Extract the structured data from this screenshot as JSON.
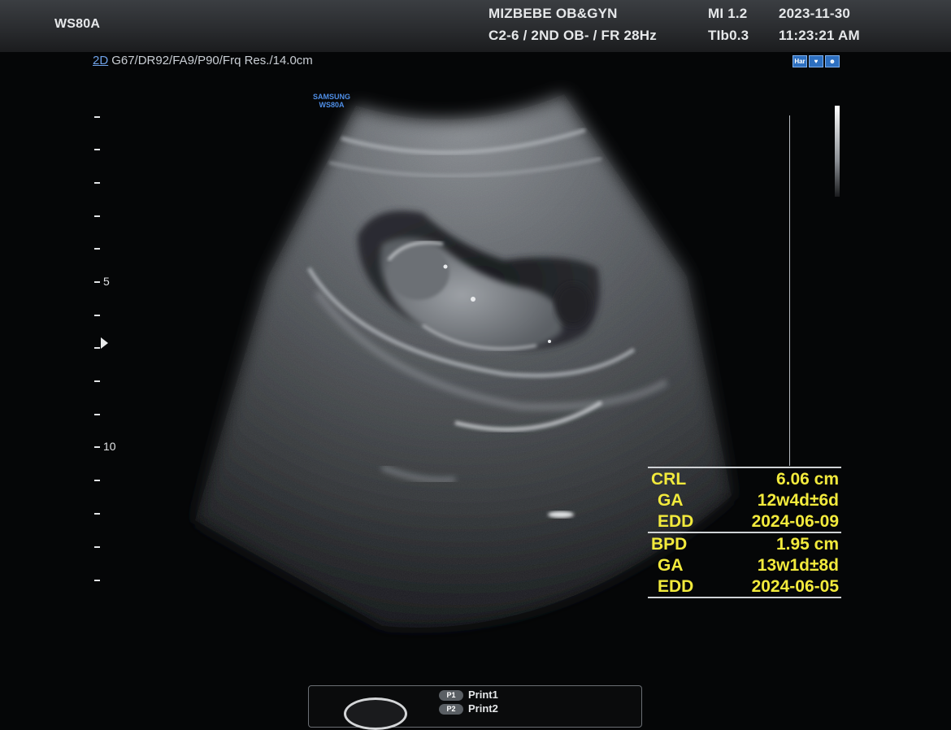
{
  "header": {
    "model": "WS80A",
    "hospital": "MIZBEBE OB&GYN",
    "probe_preset": "C2-6 / 2ND OB- / FR 28Hz",
    "mi": "MI  1.2",
    "tib": "TIb0.3",
    "date": "2023-11-30",
    "time": "11:23:21 AM"
  },
  "imaging": {
    "mode": "2D",
    "parameters": "G67/DR92/FA9/P90/Frq Res./14.0cm",
    "brand_line1": "SAMSUNG",
    "brand_line2": "WS80A"
  },
  "depth_scale": {
    "label_5": "5",
    "label_10": "10"
  },
  "icons": [
    "har-icon",
    "fetal-heart-icon",
    "fetal-face-icon"
  ],
  "icon_labels": {
    "har": "Har",
    "heart": "♥",
    "face": "☻"
  },
  "measurements": {
    "crl": {
      "label": "CRL",
      "value": "6.06 cm",
      "ga_label": "GA",
      "ga": "12w4d±6d",
      "edd_label": "EDD",
      "edd": "2024-06-09"
    },
    "bpd": {
      "label": "BPD",
      "value": "1.95 cm",
      "ga_label": "GA",
      "ga": "13w1d±8d",
      "edd_label": "EDD",
      "edd": "2024-06-05"
    }
  },
  "print_panel": {
    "p1_badge": "P1",
    "p1_label": "Print1",
    "p2_badge": "P2",
    "p2_label": "Print2"
  },
  "colors": {
    "measurement_text": "#f2ea3c",
    "mode_accent": "#6fa2e8",
    "brand": "#4f8ee6"
  }
}
